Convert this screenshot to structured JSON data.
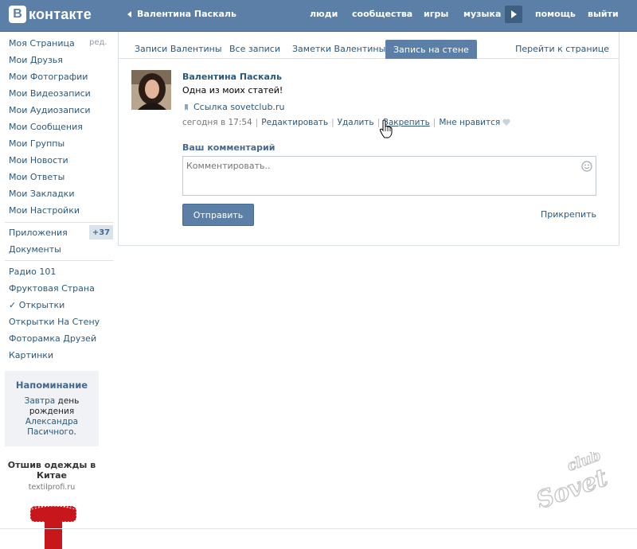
{
  "header": {
    "logo_letter": "В",
    "logo_text": "контакте",
    "back_user": "Валентина Паскаль",
    "nav": [
      "люди",
      "сообщества",
      "игры",
      "музыка",
      "помощь",
      "выйти"
    ]
  },
  "sidebar": {
    "edit_label": "ред.",
    "items": [
      "Моя Страница",
      "Мои Друзья",
      "Мои Фотографии",
      "Мои Видеозаписи",
      "Мои Аудиозаписи",
      "Мои Сообщения",
      "Мои Группы",
      "Мои Новости",
      "Мои Ответы",
      "Мои Закладки",
      "Мои Настройки"
    ],
    "apps_label": "Приложения",
    "apps_badge": "+37",
    "docs_label": "Документы",
    "apps": [
      "Радио 101",
      "Фруктовая Страна",
      "✓ Открытки",
      "Открытки На Стену",
      "Фоторамка Друзей",
      "Картинки"
    ]
  },
  "reminder": {
    "title": "Напоминание",
    "line1_link": "Завтра",
    "line1_rest": " день",
    "line2": "рождения",
    "line3_link": "Александра",
    "line4_link": "Пасичного",
    "line4_rest": "."
  },
  "ad": {
    "title": "Отшив одежды в Китае",
    "domain": "textilprofi.ru"
  },
  "tabs": {
    "items": [
      "Записи Валентины",
      "Все записи",
      "Заметки Валентины"
    ],
    "active": "Запись на стене",
    "goto": "Перейти к странице"
  },
  "post": {
    "author": "Валентина Паскаль",
    "text": "Одна из моих статей!",
    "link": "Ссылка sovetclub.ru",
    "time": "сегодня в 17:54",
    "actions": [
      "Редактировать",
      "Удалить",
      "Закрепить",
      "Мне нравится"
    ]
  },
  "comment": {
    "label": "Ваш комментарий",
    "placeholder": "Комментировать..",
    "send": "Отправить",
    "attach": "Прикрепить"
  },
  "watermark": {
    "line1": "club",
    "line2": "Sovet"
  },
  "colors": {
    "header": "#5b7fa6",
    "link": "#2b587a",
    "panel_border": "#d8dfe6"
  }
}
